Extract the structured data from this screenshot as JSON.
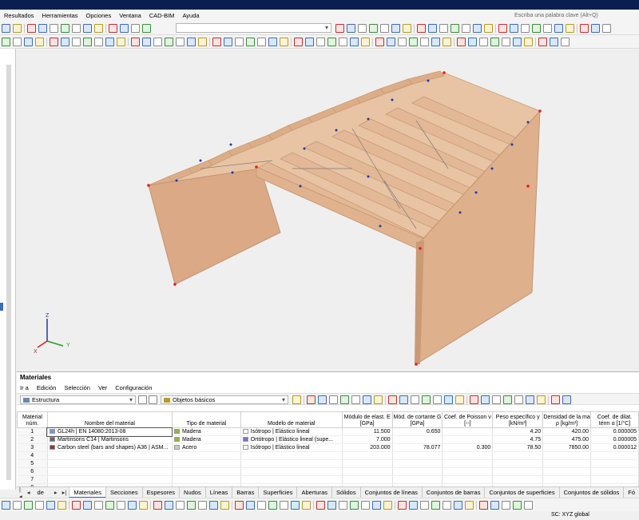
{
  "menu": [
    "Resultados",
    "Herramientas",
    "Opciones",
    "Ventana",
    "CAD-BIM",
    "Ayuda"
  ],
  "search_placeholder": "Escriba una palabra clave (Alt+Q)",
  "axes": {
    "z": "Z",
    "x": "X",
    "y": "Y"
  },
  "panel": {
    "title": "Materiales",
    "menu": [
      "Ir a",
      "Edición",
      "Selección",
      "Ver",
      "Configuración"
    ],
    "structure_select": "Estructura",
    "objects_select": "Objetos básicos"
  },
  "table": {
    "headers": [
      "Material núm.",
      "Nombre del material",
      "Tipo de material",
      "Modelo de material",
      "Módulo de elast. E [GPa]",
      "Mód. de cortante G [GPa]",
      "Coef. de Poisson ν [--]",
      "Peso específico γ [kN/m³]",
      "Densidad de la ma ρ [kg/m³]",
      "Coef. de dilat. térm α [1/°C]"
    ],
    "rows": [
      {
        "num": "1",
        "name": "GL24h | EN 14080:2013-08",
        "name_color": "#6b9bd8",
        "type": "Madera",
        "type_color": "#8fb836",
        "model": "Isótropo | Elástico lineal",
        "model_color": "#ffffff",
        "E": "11.500",
        "G": "0.650",
        "nu": "",
        "gamma": "4.20",
        "rho": "420.00",
        "alpha": "0.000005"
      },
      {
        "num": "2",
        "name": "Martinsons C14 | Martinsons",
        "name_color": "#666666",
        "type": "Madera",
        "type_color": "#8fb836",
        "model": "Ortótropo | Elástico lineal (supe...",
        "model_color": "#7a6fd0",
        "E": "7.000",
        "G": "",
        "nu": "",
        "gamma": "4.75",
        "rho": "475.00",
        "alpha": "0.000005"
      },
      {
        "num": "3",
        "name": "Carbon steel (bars and shapes) A36 | ASM...",
        "name_color": "#8a3a3a",
        "type": "Acero",
        "type_color": "#c8c8c8",
        "model": "Isótropo | Elástico lineal",
        "model_color": "#ffffff",
        "E": "203.000",
        "G": "78.077",
        "nu": "0.300",
        "gamma": "78.50",
        "rho": "7850.00",
        "alpha": "0.000012"
      },
      {
        "num": "4",
        "name": "",
        "name_color": "",
        "type": "",
        "type_color": "",
        "model": "",
        "model_color": "",
        "E": "",
        "G": "",
        "nu": "",
        "gamma": "",
        "rho": "",
        "alpha": ""
      },
      {
        "num": "5",
        "name": "",
        "name_color": "",
        "type": "",
        "type_color": "",
        "model": "",
        "model_color": "",
        "E": "",
        "G": "",
        "nu": "",
        "gamma": "",
        "rho": "",
        "alpha": ""
      },
      {
        "num": "6",
        "name": "",
        "name_color": "",
        "type": "",
        "type_color": "",
        "model": "",
        "model_color": "",
        "E": "",
        "G": "",
        "nu": "",
        "gamma": "",
        "rho": "",
        "alpha": ""
      },
      {
        "num": "7",
        "name": "",
        "name_color": "",
        "type": "",
        "type_color": "",
        "model": "",
        "model_color": "",
        "E": "",
        "G": "",
        "nu": "",
        "gamma": "",
        "rho": "",
        "alpha": ""
      },
      {
        "num": "8",
        "name": "",
        "name_color": "",
        "type": "",
        "type_color": "",
        "model": "",
        "model_color": "",
        "E": "",
        "G": "",
        "nu": "",
        "gamma": "",
        "rho": "",
        "alpha": ""
      }
    ]
  },
  "pager": "1 de 14",
  "tabs": [
    "Materiales",
    "Secciones",
    "Espesores",
    "Nudos",
    "Líneas",
    "Barras",
    "Superficies",
    "Aberturas",
    "Sólidos",
    "Conjuntos de líneas",
    "Conjuntos de barras",
    "Conjuntos de superficies",
    "Conjuntos de sólidos",
    "Fó"
  ],
  "status": {
    "cs": "SC: XYZ global"
  },
  "colors": {
    "wood": "#e3b896",
    "wood_dark": "#cfa07c",
    "titlebar": "#0a1f4f",
    "accent": "#3b6db5"
  }
}
